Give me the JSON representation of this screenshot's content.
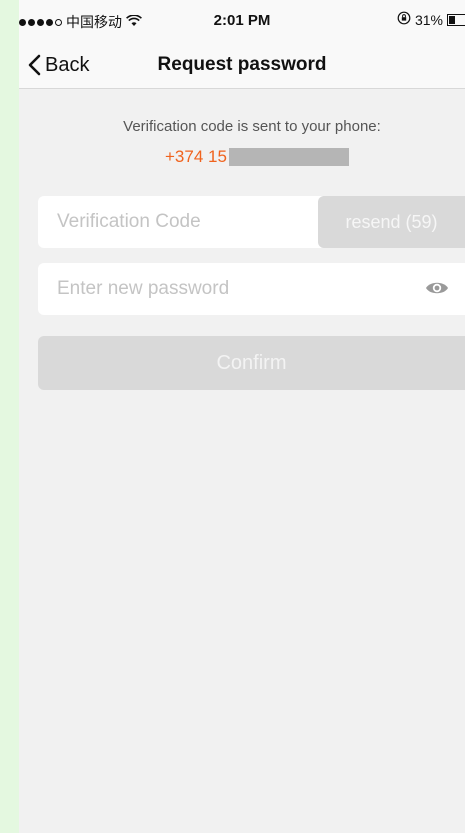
{
  "status_bar": {
    "carrier": "中国移动",
    "time": "2:01 PM",
    "battery_percent": "31%",
    "battery_level": 0.31,
    "signal_bars_filled": 4,
    "signal_bars_total": 5,
    "icons": [
      "signal-dots-icon",
      "wifi-icon",
      "rotation-lock-icon",
      "battery-icon"
    ]
  },
  "nav": {
    "back_label": "Back",
    "title": "Request password"
  },
  "verification": {
    "message": "Verification code is sent to your phone:",
    "phone_prefix": "+374 15"
  },
  "form": {
    "code_placeholder": "Verification Code",
    "resend_label": "resend (59)",
    "password_placeholder": "Enter new password",
    "confirm_label": "Confirm"
  },
  "colors": {
    "accent_orange": "#f0631e",
    "disabled_button": "#d9d9d9",
    "background": "#f1f1f1",
    "outer_background": "#e4f8e0"
  }
}
